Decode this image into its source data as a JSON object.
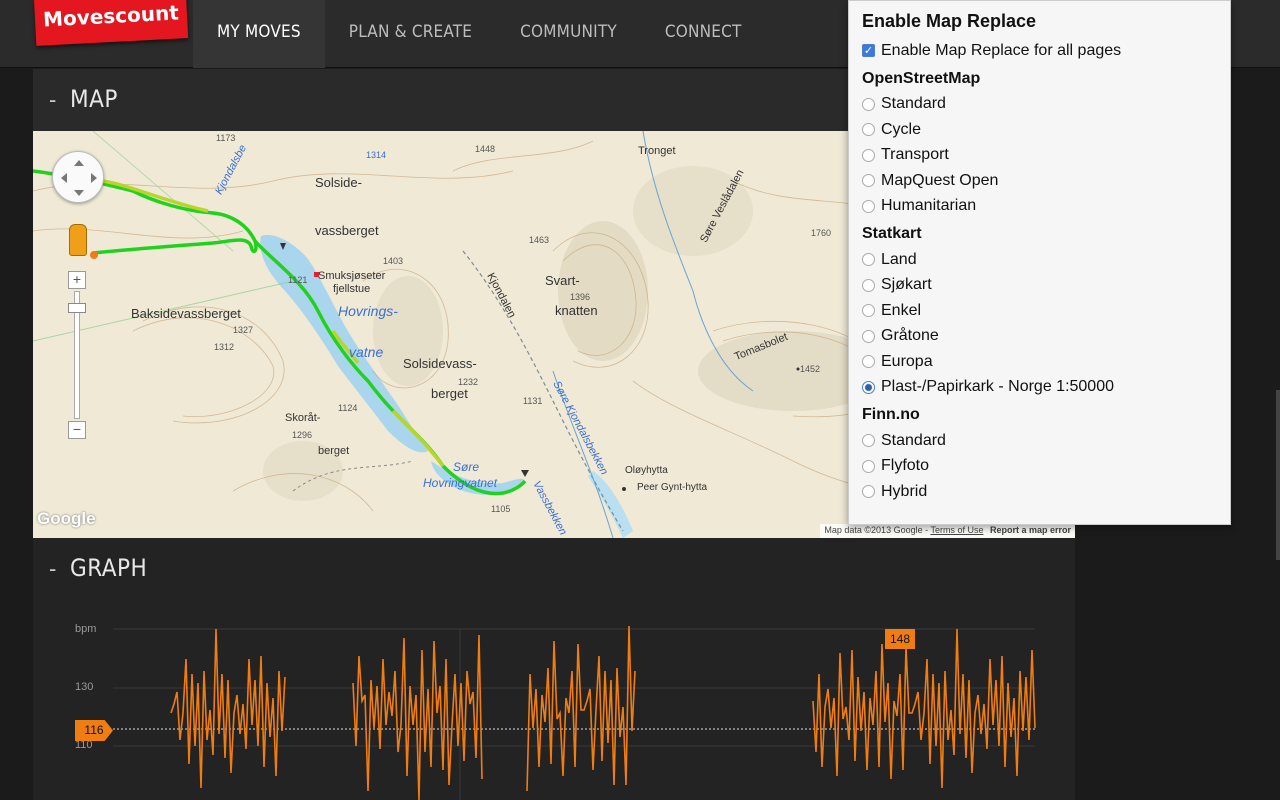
{
  "header": {
    "logo": "Movescount",
    "nav": [
      "MY MOVES",
      "PLAN & CREATE",
      "COMMUNITY",
      "CONNECT"
    ]
  },
  "map_section": {
    "toggle": "-",
    "title": "MAP",
    "labels": {
      "solside": "Solside-",
      "vassberget": "vassberget",
      "smuksjoseter": "Smuksjøseter",
      "fjellstue": "fjellstue",
      "hovrings": "Hovrings-",
      "vatne": "vatne",
      "baksidevassberget": "Baksidevassberget",
      "solsidevass": "Solsidevass-",
      "berget": "berget",
      "skoratberget1": "Skoråt-",
      "skoratberget2": "berget",
      "sore": "Søre",
      "hovringvatnet": "Hovringvatnet",
      "svart": "Svart-",
      "knatten": "knatten",
      "kjondalen": "Kjondalen",
      "tronget": "Tronget",
      "sore_vesledalen": "Søre Veslådalen",
      "tomasbolet": "Tomasbolet",
      "oloyhytta": "Oløyhytta",
      "peer_gynt": "Peer Gynt-hytta",
      "vassbekken": "Vassbekken",
      "sore_kjondalsbekken": "Søre Kjondalsbekken",
      "kjondalsbe": "Kjondalsbe"
    },
    "elevations": [
      "1173",
      "1448",
      "1463",
      "1403",
      "1121",
      "1327",
      "1312",
      "1232",
      "1296",
      "1124",
      "1131",
      "1396",
      "1105",
      "1314",
      "1760",
      "1452"
    ],
    "google_logo": "Google",
    "attribution": "Map data ©2013 Google -",
    "terms": "Terms of Use",
    "report": "Report a map error"
  },
  "map_replace": {
    "title": "Enable Map Replace",
    "enable_label": "Enable Map Replace for all pages",
    "enabled": true,
    "groups": [
      {
        "name": "OpenStreetMap",
        "options": [
          "Standard",
          "Cycle",
          "Transport",
          "MapQuest Open",
          "Humanitarian"
        ]
      },
      {
        "name": "Statkart",
        "options": [
          "Land",
          "Sjøkart",
          "Enkel",
          "Gråtone",
          "Europa",
          "Plast-/Papirkark - Norge 1:50000"
        ]
      },
      {
        "name": "Finn.no",
        "options": [
          "Standard",
          "Flyfoto",
          "Hybrid"
        ]
      }
    ],
    "selected": "Plast-/Papirkark - Norge 1:50000"
  },
  "graph_section": {
    "toggle": "-",
    "title": "GRAPH",
    "unit": "bpm",
    "y_ticks": [
      "130",
      "110"
    ],
    "avg_marker": "116",
    "max_marker": "148",
    "colors": {
      "series": "#f07d12",
      "grid": "#3a3a3a"
    }
  },
  "chart_data": {
    "type": "line",
    "ylabel": "bpm",
    "ylim": [
      90,
      150
    ],
    "series": [
      {
        "values": [
          124,
          120,
          128,
          105,
          118,
          140,
          98,
          132,
          112,
          126,
          95,
          138,
          108,
          122,
          100,
          146,
          115,
          128,
          104,
          134,
          96,
          120,
          130,
          110,
          124,
          102,
          136,
          118,
          126,
          108,
          142,
          98,
          130,
          116,
          122,
          100,
          128,
          112,
          134,
          106,
          140,
          118,
          124,
          96,
          126,
          114,
          132,
          104,
          138,
          120
        ]
      }
    ],
    "average": 116,
    "max": 148
  },
  "colors": {
    "accent_red": "#e4161f",
    "route_green": "#22d11e",
    "route_yellow": "#b9d42a",
    "hr_orange": "#f07d12"
  }
}
